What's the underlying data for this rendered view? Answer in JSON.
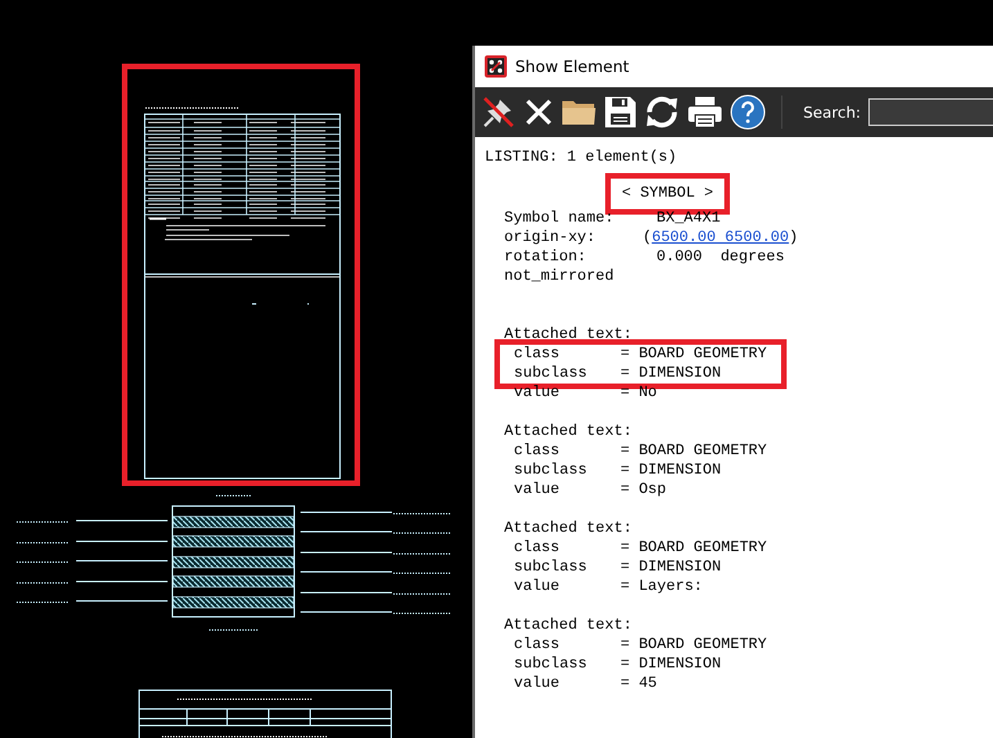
{
  "canvas": {
    "drawing_highlighted": true
  },
  "window": {
    "title": "Show Element"
  },
  "toolbar": {
    "buttons": [
      {
        "kind": "unpin"
      },
      {
        "kind": "close"
      },
      {
        "kind": "open"
      },
      {
        "kind": "save"
      },
      {
        "kind": "refresh"
      },
      {
        "kind": "print"
      },
      {
        "kind": "help"
      }
    ],
    "search": {
      "label": "Search:"
    }
  },
  "listing": {
    "header": "LISTING: 1 element(s)",
    "symbol_label": {
      "text": "< SYMBOL >",
      "highlighted": true
    },
    "fields": [
      {
        "label": "Symbol name:",
        "value": "BX_A4X1",
        "kind": "text"
      },
      {
        "label": "origin-xy:",
        "prefix": "(",
        "value": "6500.00 6500.00",
        "suffix": ")",
        "kind": "link"
      },
      {
        "label": "rotation:",
        "value": "0.000  degrees",
        "kind": "text"
      },
      {
        "label": "not_mirrored",
        "kind": "flag"
      }
    ],
    "attached_texts": [
      {
        "title": "Attached text:",
        "rows": [
          {
            "key": "class",
            "value": "= BOARD GEOMETRY",
            "highlighted": true
          },
          {
            "key": "subclass",
            "value": "= DIMENSION",
            "highlighted": true
          },
          {
            "key": "value",
            "value": "= No",
            "highlighted": false
          }
        ]
      },
      {
        "title": "Attached text:",
        "rows": [
          {
            "key": "class",
            "value": "= BOARD GEOMETRY",
            "highlighted": false
          },
          {
            "key": "subclass",
            "value": "= DIMENSION",
            "highlighted": false
          },
          {
            "key": "value",
            "value": "= Osp",
            "highlighted": false
          }
        ]
      },
      {
        "title": "Attached text:",
        "rows": [
          {
            "key": "class",
            "value": "= BOARD GEOMETRY",
            "highlighted": false
          },
          {
            "key": "subclass",
            "value": "= DIMENSION",
            "highlighted": false
          },
          {
            "key": "value",
            "value": "= Layers:",
            "highlighted": false
          }
        ]
      },
      {
        "title": "Attached text:",
        "rows": [
          {
            "key": "class",
            "value": "= BOARD GEOMETRY",
            "highlighted": false
          },
          {
            "key": "subclass",
            "value": "= DIMENSION",
            "highlighted": false
          },
          {
            "key": "value",
            "value": "= 45",
            "highlighted": false
          }
        ]
      }
    ]
  }
}
